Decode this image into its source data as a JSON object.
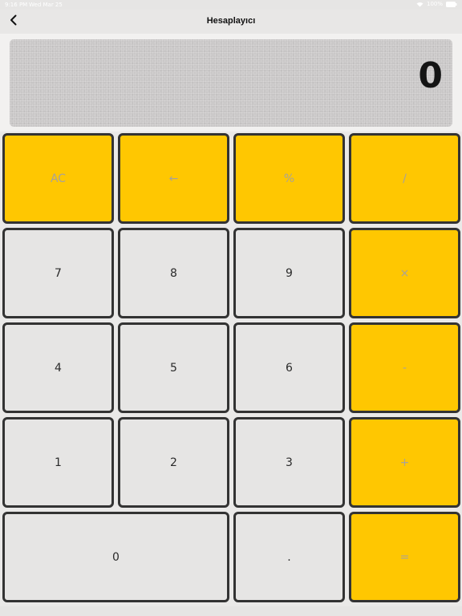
{
  "status_bar": {
    "time": "9:16 PM",
    "date": "Wed Mar 25",
    "battery": "100%"
  },
  "navbar": {
    "title": "Hesaplayıcı",
    "back_icon": "chevron-left-icon"
  },
  "display": {
    "value": "0"
  },
  "keys": {
    "ac": "AC",
    "backspace": "←",
    "percent": "%",
    "divide": "/",
    "seven": "7",
    "eight": "8",
    "nine": "9",
    "multiply": "×",
    "four": "4",
    "five": "5",
    "six": "6",
    "minus": "-",
    "one": "1",
    "two": "2",
    "three": "3",
    "plus": "+",
    "zero": "0",
    "decimal": ".",
    "equals": "="
  },
  "colors": {
    "operator_key": "#ffc701",
    "number_key": "#e6e5e4",
    "key_border": "#333333",
    "display_bg": "#c9c7c7"
  }
}
